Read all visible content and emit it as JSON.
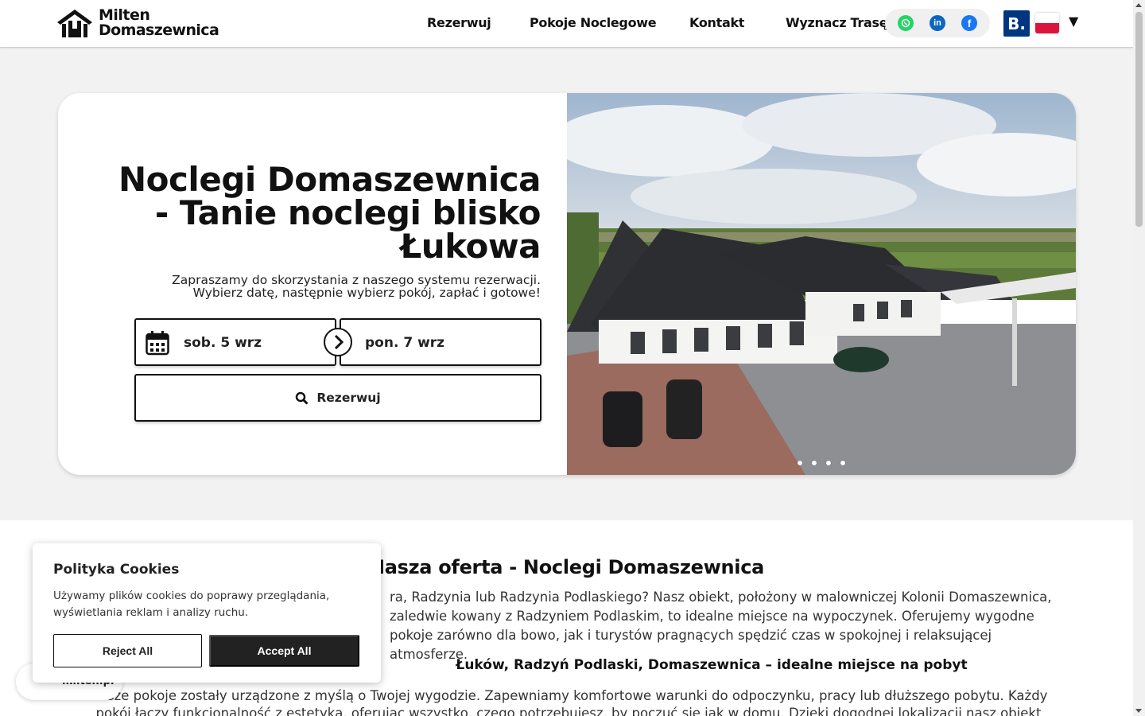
{
  "brand": {
    "line1": "Milten",
    "line2": "Domaszewnica"
  },
  "nav": {
    "items": [
      {
        "label": "Rezerwuj"
      },
      {
        "label": "Pokoje Noclegowe"
      },
      {
        "label": "Kontakt"
      },
      {
        "label": "Wyznacz Trasę"
      }
    ]
  },
  "social": {
    "whatsapp": "whatsapp-icon",
    "linkedin": "in",
    "facebook": "f"
  },
  "booking_badge": "B.",
  "language": {
    "flag": "pl-flag-icon",
    "caret": "▼"
  },
  "hero": {
    "title": "Noclegi Domaszewnica - Tanie noclegi blisko Łukowa",
    "subtitle_line1": "Zapraszamy do skorzystania z naszego systemu rezerwacji.",
    "subtitle_line2": "Wybierz datę, następnie wybierz pokój, zapłać i gotowe!",
    "date_from": "sob. 5 wrz",
    "date_to": "pon. 7 wrz",
    "book_label": "Rezerwuj",
    "slides": 4,
    "active_slide": 1
  },
  "offer": {
    "title": "Nasza oferta - Noclegi Domaszewnica",
    "paragraph": "ra, Radzynia lub Radzynia Podlaskiego? Nasz obiekt, położony w malowniczej Kolonii Domaszewnica, zaledwie kowany z Radzyniem Podlaskim, to idealne miejsce na wypoczynek. Oferujemy wygodne pokoje zarówno dla bowo, jak i turystów pragnących spędzić czas w spokojnej i relaksującej atmosferze.",
    "subheading": "Łuków, Radzyń Podlaski, Domaszewnica – idealne miejsce na pobyt",
    "paragraph2": "Nasze pokoje zostały urządzone z myślą o Twojej wygodzie. Zapewniamy komfortowe warunki do odpoczynku, pracy lub dłuższego pobytu. Każdy pokój łączy funkcjonalność z estetyką, oferując wszystko, czego potrzebujesz, by poczuć się jak w domu. Dzięki dogodnej lokalizacji nasz obiekt stanowi świetne miejsce na"
  },
  "chat": {
    "label": "milten.pl"
  },
  "cookies": {
    "title": "Polityka Cookies",
    "text": "Używamy plików cookies do poprawy przeglądania, wyświetlania reklam i analizy ruchu.",
    "reject": "Reject All",
    "accept": "Accept All"
  },
  "colors": {
    "booking": "#003580",
    "whatsapp": "#25d366",
    "linkedin": "#0a66c2",
    "facebook": "#1877f2",
    "accent_dark": "#222222"
  }
}
